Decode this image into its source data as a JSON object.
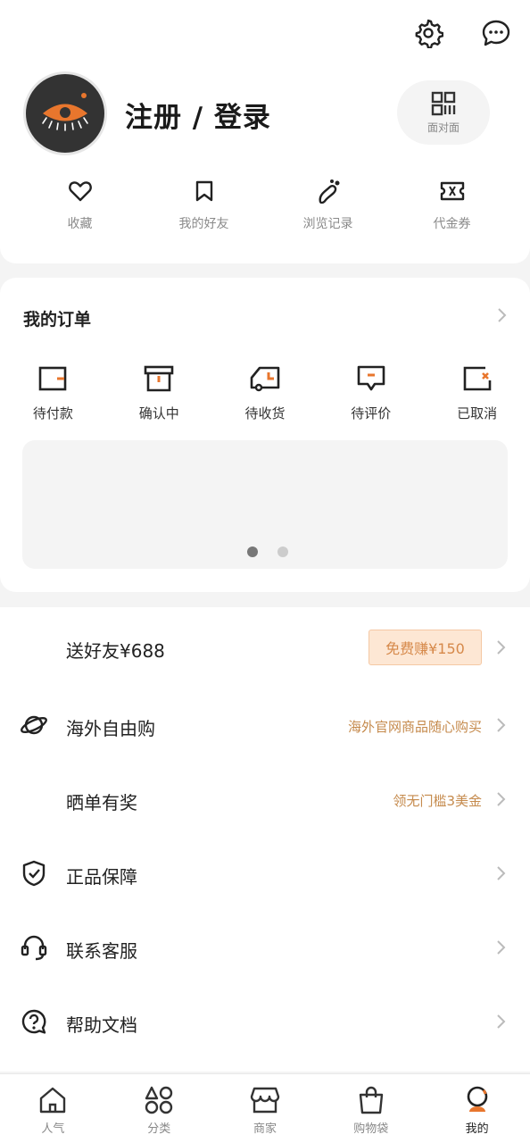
{
  "header": {
    "settings_icon": "gear-icon",
    "messages_icon": "chat-bubble-icon"
  },
  "profile": {
    "login_label": "注册 / 登录",
    "face_to_face_label": "面对面"
  },
  "quick_links": [
    {
      "label": "收藏",
      "icon": "heart-icon"
    },
    {
      "label": "我的好友",
      "icon": "bookmark-icon"
    },
    {
      "label": "浏览记录",
      "icon": "footprint-icon"
    },
    {
      "label": "代金券",
      "icon": "ticket-icon"
    }
  ],
  "orders": {
    "title": "我的订单",
    "statuses": [
      {
        "label": "待付款"
      },
      {
        "label": "确认中"
      },
      {
        "label": "待收货"
      },
      {
        "label": "待评价"
      },
      {
        "label": "已取消"
      }
    ],
    "banner_page": 1,
    "banner_pages": 2
  },
  "menu": [
    {
      "label": "送好友¥688",
      "badge": "免费赚¥150"
    },
    {
      "label": "海外自由购",
      "extra": "海外官网商品随心购买",
      "icon": "planet-icon"
    },
    {
      "label": "晒单有奖",
      "extra": "领无门槛3美金"
    },
    {
      "label": "正品保障",
      "icon": "shield-check-icon"
    },
    {
      "label": "联系客服",
      "icon": "headset-icon"
    },
    {
      "label": "帮助文档",
      "icon": "question-bubble-icon"
    }
  ],
  "tabs": [
    {
      "label": "人气",
      "icon": "home-icon"
    },
    {
      "label": "分类",
      "icon": "category-icon"
    },
    {
      "label": "商家",
      "icon": "store-icon"
    },
    {
      "label": "购物袋",
      "icon": "shopping-bag-icon"
    },
    {
      "label": "我的",
      "icon": "profile-icon",
      "active": true
    }
  ],
  "colors": {
    "accent": "#e8762d",
    "extra_text": "#c58a4c",
    "badge_bg": "#fde7d4"
  }
}
